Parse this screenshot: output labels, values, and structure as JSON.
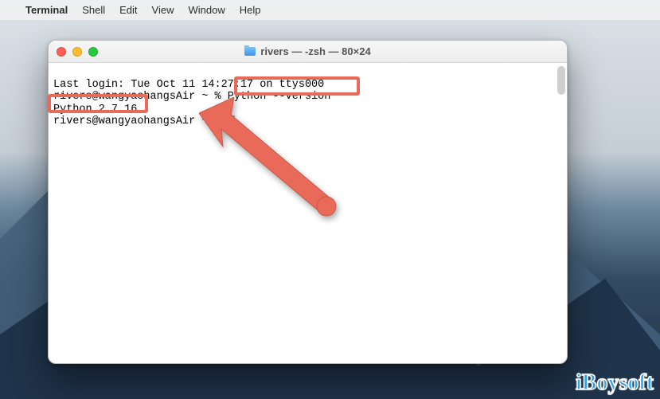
{
  "menubar": {
    "apple": "",
    "appname": "Terminal",
    "items": [
      "Shell",
      "Edit",
      "View",
      "Window",
      "Help"
    ]
  },
  "window": {
    "title": "rivers — -zsh — 80×24"
  },
  "terminal": {
    "line1_prefix": "Last login: Tue Oct 11 14:",
    "line1_obscured": "27:17 on ttys000",
    "line2_prompt_obscured": "rivers@wangyaohangsAir",
    "prompt_tail": " ~ % ",
    "command": "Python --version",
    "output": "Python 2.7.16",
    "line4_prompt": "rivers@wangyaohangsAir",
    "line4_tail": " ~ % "
  },
  "watermark": "iBoysoft",
  "annotations": {
    "box_command": "highlight box around \"Python --version\"",
    "box_output": "highlight box around \"Python 2.7.16\"",
    "arrow": "red arrow pointing to current prompt cursor"
  },
  "icons": {
    "folder": "folder-icon",
    "apple": "apple-logo"
  },
  "colors": {
    "annotation": "#ea6a5a",
    "traffic_red": "#ff5f57",
    "traffic_yellow": "#febc2e",
    "traffic_green": "#28c840",
    "watermark_blue": "#2ea0e6"
  }
}
